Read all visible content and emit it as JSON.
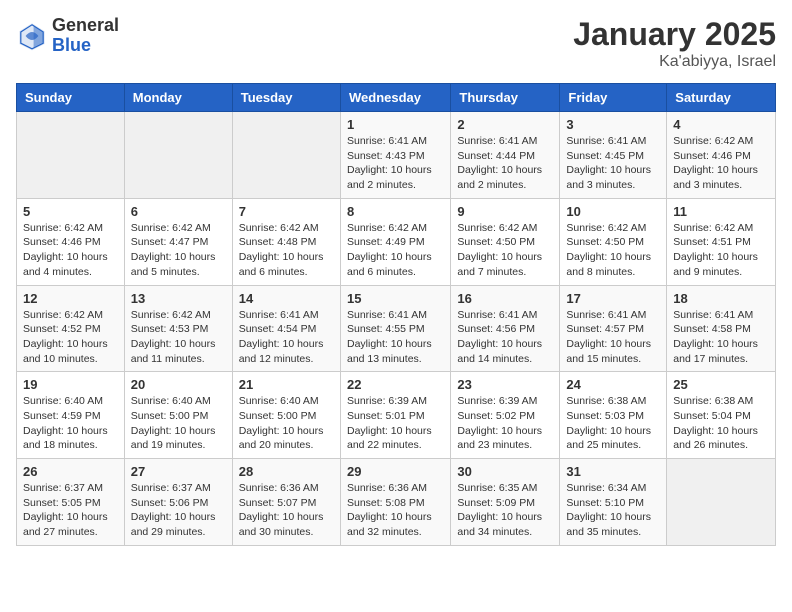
{
  "header": {
    "logo_general": "General",
    "logo_blue": "Blue",
    "title": "January 2025",
    "subtitle": "Ka'abiyya, Israel"
  },
  "days_of_week": [
    "Sunday",
    "Monday",
    "Tuesday",
    "Wednesday",
    "Thursday",
    "Friday",
    "Saturday"
  ],
  "weeks": [
    [
      {
        "day": "",
        "info": ""
      },
      {
        "day": "",
        "info": ""
      },
      {
        "day": "",
        "info": ""
      },
      {
        "day": "1",
        "info": "Sunrise: 6:41 AM\nSunset: 4:43 PM\nDaylight: 10 hours\nand 2 minutes."
      },
      {
        "day": "2",
        "info": "Sunrise: 6:41 AM\nSunset: 4:44 PM\nDaylight: 10 hours\nand 2 minutes."
      },
      {
        "day": "3",
        "info": "Sunrise: 6:41 AM\nSunset: 4:45 PM\nDaylight: 10 hours\nand 3 minutes."
      },
      {
        "day": "4",
        "info": "Sunrise: 6:42 AM\nSunset: 4:46 PM\nDaylight: 10 hours\nand 3 minutes."
      }
    ],
    [
      {
        "day": "5",
        "info": "Sunrise: 6:42 AM\nSunset: 4:46 PM\nDaylight: 10 hours\nand 4 minutes."
      },
      {
        "day": "6",
        "info": "Sunrise: 6:42 AM\nSunset: 4:47 PM\nDaylight: 10 hours\nand 5 minutes."
      },
      {
        "day": "7",
        "info": "Sunrise: 6:42 AM\nSunset: 4:48 PM\nDaylight: 10 hours\nand 6 minutes."
      },
      {
        "day": "8",
        "info": "Sunrise: 6:42 AM\nSunset: 4:49 PM\nDaylight: 10 hours\nand 6 minutes."
      },
      {
        "day": "9",
        "info": "Sunrise: 6:42 AM\nSunset: 4:50 PM\nDaylight: 10 hours\nand 7 minutes."
      },
      {
        "day": "10",
        "info": "Sunrise: 6:42 AM\nSunset: 4:50 PM\nDaylight: 10 hours\nand 8 minutes."
      },
      {
        "day": "11",
        "info": "Sunrise: 6:42 AM\nSunset: 4:51 PM\nDaylight: 10 hours\nand 9 minutes."
      }
    ],
    [
      {
        "day": "12",
        "info": "Sunrise: 6:42 AM\nSunset: 4:52 PM\nDaylight: 10 hours\nand 10 minutes."
      },
      {
        "day": "13",
        "info": "Sunrise: 6:42 AM\nSunset: 4:53 PM\nDaylight: 10 hours\nand 11 minutes."
      },
      {
        "day": "14",
        "info": "Sunrise: 6:41 AM\nSunset: 4:54 PM\nDaylight: 10 hours\nand 12 minutes."
      },
      {
        "day": "15",
        "info": "Sunrise: 6:41 AM\nSunset: 4:55 PM\nDaylight: 10 hours\nand 13 minutes."
      },
      {
        "day": "16",
        "info": "Sunrise: 6:41 AM\nSunset: 4:56 PM\nDaylight: 10 hours\nand 14 minutes."
      },
      {
        "day": "17",
        "info": "Sunrise: 6:41 AM\nSunset: 4:57 PM\nDaylight: 10 hours\nand 15 minutes."
      },
      {
        "day": "18",
        "info": "Sunrise: 6:41 AM\nSunset: 4:58 PM\nDaylight: 10 hours\nand 17 minutes."
      }
    ],
    [
      {
        "day": "19",
        "info": "Sunrise: 6:40 AM\nSunset: 4:59 PM\nDaylight: 10 hours\nand 18 minutes."
      },
      {
        "day": "20",
        "info": "Sunrise: 6:40 AM\nSunset: 5:00 PM\nDaylight: 10 hours\nand 19 minutes."
      },
      {
        "day": "21",
        "info": "Sunrise: 6:40 AM\nSunset: 5:00 PM\nDaylight: 10 hours\nand 20 minutes."
      },
      {
        "day": "22",
        "info": "Sunrise: 6:39 AM\nSunset: 5:01 PM\nDaylight: 10 hours\nand 22 minutes."
      },
      {
        "day": "23",
        "info": "Sunrise: 6:39 AM\nSunset: 5:02 PM\nDaylight: 10 hours\nand 23 minutes."
      },
      {
        "day": "24",
        "info": "Sunrise: 6:38 AM\nSunset: 5:03 PM\nDaylight: 10 hours\nand 25 minutes."
      },
      {
        "day": "25",
        "info": "Sunrise: 6:38 AM\nSunset: 5:04 PM\nDaylight: 10 hours\nand 26 minutes."
      }
    ],
    [
      {
        "day": "26",
        "info": "Sunrise: 6:37 AM\nSunset: 5:05 PM\nDaylight: 10 hours\nand 27 minutes."
      },
      {
        "day": "27",
        "info": "Sunrise: 6:37 AM\nSunset: 5:06 PM\nDaylight: 10 hours\nand 29 minutes."
      },
      {
        "day": "28",
        "info": "Sunrise: 6:36 AM\nSunset: 5:07 PM\nDaylight: 10 hours\nand 30 minutes."
      },
      {
        "day": "29",
        "info": "Sunrise: 6:36 AM\nSunset: 5:08 PM\nDaylight: 10 hours\nand 32 minutes."
      },
      {
        "day": "30",
        "info": "Sunrise: 6:35 AM\nSunset: 5:09 PM\nDaylight: 10 hours\nand 34 minutes."
      },
      {
        "day": "31",
        "info": "Sunrise: 6:34 AM\nSunset: 5:10 PM\nDaylight: 10 hours\nand 35 minutes."
      },
      {
        "day": "",
        "info": ""
      }
    ]
  ]
}
